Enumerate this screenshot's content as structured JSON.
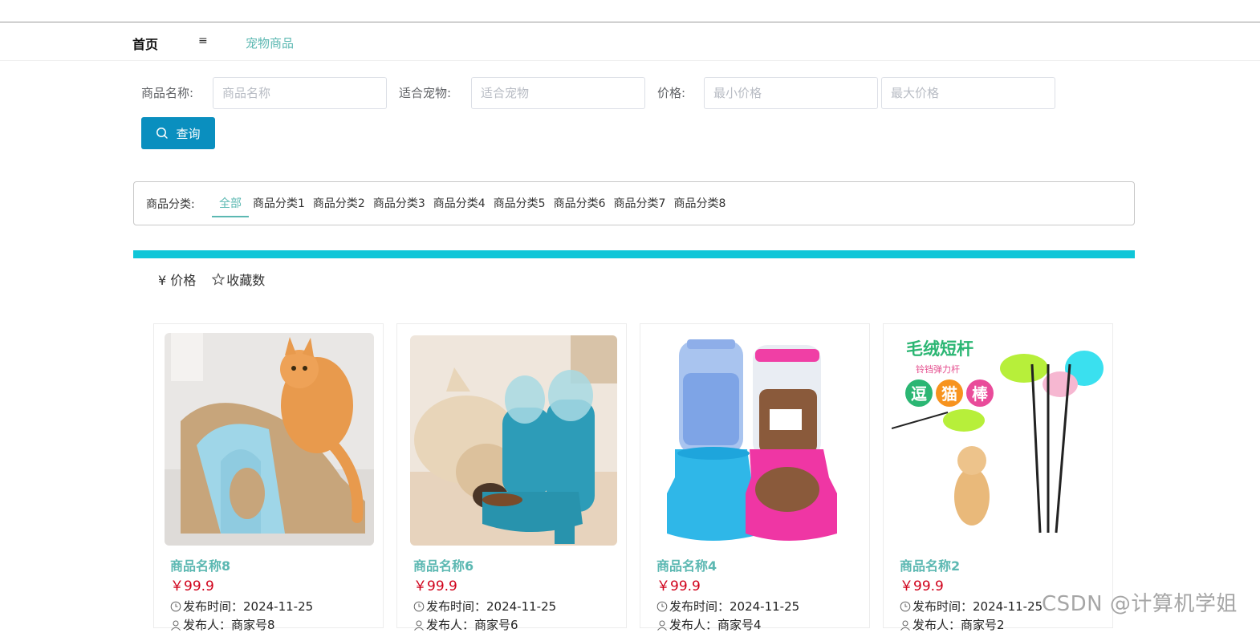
{
  "nav": {
    "home": "首页",
    "separator": "≡",
    "current": "宠物商品"
  },
  "search": {
    "name_label": "商品名称:",
    "name_placeholder": "商品名称",
    "pet_label": "适合宠物:",
    "pet_placeholder": "适合宠物",
    "price_label": "价格:",
    "min_placeholder": "最小价格",
    "max_placeholder": "最大价格",
    "button_label": "查询"
  },
  "category": {
    "label": "商品分类:",
    "items": [
      "全部",
      "商品分类1",
      "商品分类2",
      "商品分类3",
      "商品分类4",
      "商品分类5",
      "商品分类6",
      "商品分类7",
      "商品分类8"
    ],
    "active_index": 0
  },
  "sort": {
    "price_label": "¥ 价格",
    "fav_label": "收藏数"
  },
  "products": [
    {
      "name": "商品名称8",
      "price": "￥99.9",
      "publish_time": "发布时间：2024-11-25",
      "publisher": "发布人：商家号8",
      "image": "cat-scratcher-photo"
    },
    {
      "name": "商品名称6",
      "price": "￥99.9",
      "publish_time": "发布时间：2024-11-25",
      "publisher": "发布人：商家号6",
      "image": "dog-feeder-photo"
    },
    {
      "name": "商品名称4",
      "price": "￥99.9",
      "publish_time": "发布时间：2024-11-25",
      "publisher": "发布人：商家号4",
      "image": "water-food-dispenser-photo"
    },
    {
      "name": "商品名称2",
      "price": "￥99.9",
      "publish_time": "发布时间：2024-11-25",
      "publisher": "发布人：商家号2",
      "image": "cat-teaser-wand-photo"
    }
  ],
  "teaser_banner": {
    "line1": "毛绒短杆",
    "line2": "铃铛弹力杆",
    "chars": [
      "逗",
      "猫",
      "棒"
    ]
  },
  "watermark": "CSDN @计算机学姐",
  "colors": {
    "accent": "#5cb8b2",
    "primary_button": "#0a8fbf",
    "bar": "#10c6d8",
    "price": "#d0021b"
  }
}
